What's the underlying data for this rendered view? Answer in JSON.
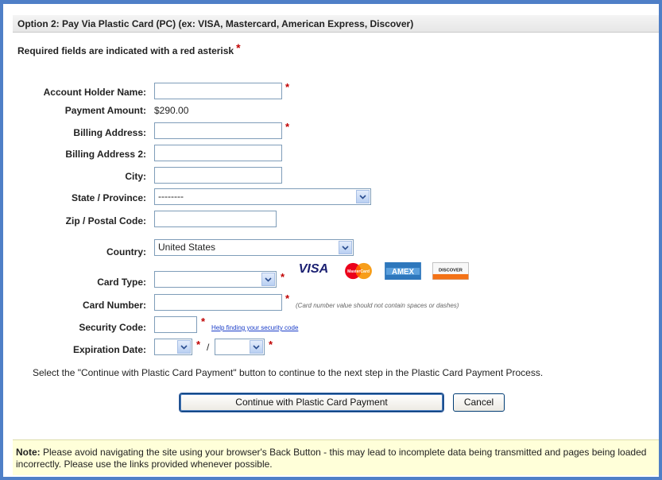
{
  "header": {
    "title": "Option 2: Pay Via Plastic Card (PC) (ex: VISA, Mastercard, American Express, Discover)"
  },
  "required_note": {
    "text": "Required fields are indicated with a red asterisk",
    "asterisk": "*"
  },
  "form": {
    "account_holder_label": "Account Holder Name:",
    "account_holder_value": "",
    "payment_amount_label": "Payment Amount:",
    "payment_amount_value": "$290.00",
    "billing_address_label": "Billing Address:",
    "billing_address_value": "",
    "billing_address2_label": "Billing Address 2:",
    "billing_address2_value": "",
    "city_label": "City:",
    "city_value": "",
    "state_label": "State / Province:",
    "state_value": "--------",
    "zip_label": "Zip / Postal Code:",
    "zip_value": "",
    "country_label": "Country:",
    "country_value": "United States",
    "card_type_label": "Card Type:",
    "card_type_value": "",
    "card_number_label": "Card Number:",
    "card_number_value": "",
    "card_number_hint": "(Card number value should not contain spaces or dashes)",
    "security_code_label": "Security Code:",
    "security_code_value": "",
    "security_help_link": "Help finding your security code",
    "expiration_label": "Expiration Date:",
    "expiration_month_value": "",
    "expiration_year_value": "",
    "expiration_separator": "/",
    "required_mark": "*"
  },
  "card_logos": {
    "visa": "VISA",
    "mastercard": "MasterCard",
    "amex": "AMEX",
    "discover": "DISCOVER"
  },
  "instructions": "Select the \"Continue with Plastic Card Payment\" button to continue to the next step in the Plastic Card Payment Process.",
  "buttons": {
    "continue_label": "Continue with Plastic Card Payment",
    "cancel_label": "Cancel"
  },
  "note": {
    "prefix": "Note:",
    "text": " Please avoid navigating the site using your browser's Back Button - this may lead to incomplete data being transmitted and pages being loaded incorrectly. Please use the links provided whenever possible."
  },
  "colors": {
    "frame_border": "#4f7fc7",
    "required_red": "#c00000",
    "note_background": "#ffffd9",
    "link_blue": "#1a3dc8"
  }
}
